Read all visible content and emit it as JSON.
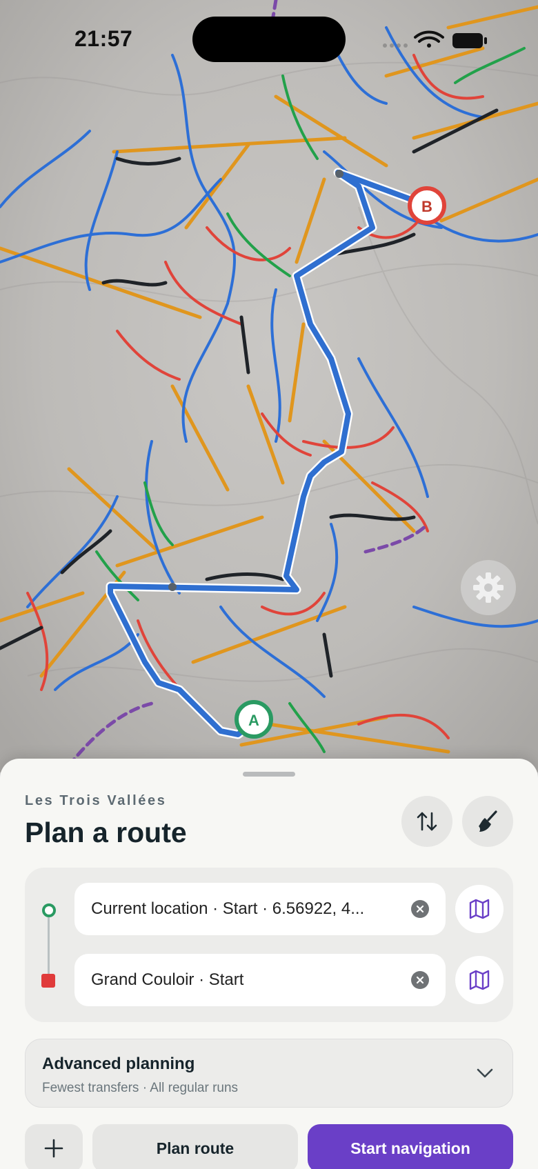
{
  "status_bar": {
    "time": "21:57"
  },
  "map": {
    "start_marker": "A",
    "end_marker": "B",
    "colors": {
      "route": "#2f6fd0",
      "piste_blue": "#2d6fd6",
      "piste_red": "#e0443a",
      "piste_black": "#1f2328",
      "piste_green": "#22a14a",
      "lift": "#e0961e",
      "path_purple": "#7b4aa8"
    }
  },
  "settings_icon": "gear-icon",
  "sheet": {
    "region": "Les Trois Vallées",
    "title": "Plan a route",
    "origin": "Current location · Start · 6.56922, 4...",
    "destination": "Grand Couloir · Start",
    "advanced": {
      "title": "Advanced planning",
      "subtitle": "Fewest transfers · All regular runs"
    },
    "actions": {
      "plan": "Plan route",
      "start": "Start navigation"
    }
  },
  "accent": "#6a3fc7"
}
